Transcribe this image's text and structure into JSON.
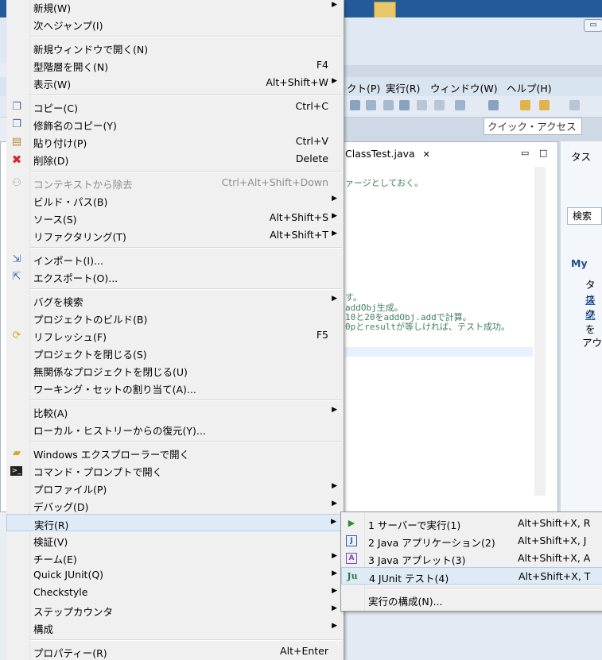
{
  "background": {
    "menubar": [
      "クト(P)",
      "実行(R)",
      "ウィンドウ(W)",
      "ヘルプ(H)"
    ],
    "quick_access": "クイック・アクセス",
    "editor_tab": "ClassTest.java",
    "editor_lines": [
      "ァージとしておく。",
      "す。",
      "addObj生成。",
      "10と20をaddObj.addで計算。",
      "0pとresultが等しければ、テスト成功。"
    ],
    "right_panel": {
      "tasks": "タス",
      "search": "検索",
      "mylyn": "My",
      "task_line": "タス",
      "link": "接続",
      "click_line": "クを",
      "outline": "アウ"
    }
  },
  "menu": {
    "items": [
      {
        "label": "新規(W)",
        "shortcut": "",
        "submenu": true,
        "icon": "",
        "disabled": false
      },
      {
        "label": "次へジャンプ(I)",
        "shortcut": "",
        "submenu": false,
        "icon": "",
        "disabled": false
      },
      {
        "label": "新規ウィンドウで開く(N)",
        "shortcut": "",
        "submenu": false,
        "icon": "",
        "disabled": false
      },
      {
        "label": "型階層を開く(N)",
        "shortcut": "F4",
        "submenu": false,
        "icon": "",
        "disabled": false
      },
      {
        "label": "表示(W)",
        "shortcut": "Alt+Shift+W",
        "submenu": true,
        "icon": "",
        "disabled": false
      },
      {
        "label": "コピー(C)",
        "shortcut": "Ctrl+C",
        "submenu": false,
        "icon": "copy-icon",
        "disabled": false
      },
      {
        "label": "修飾名のコピー(Y)",
        "shortcut": "",
        "submenu": false,
        "icon": "copy-qualified-icon",
        "disabled": false
      },
      {
        "label": "貼り付け(P)",
        "shortcut": "Ctrl+V",
        "submenu": false,
        "icon": "paste-icon",
        "disabled": false
      },
      {
        "label": "削除(D)",
        "shortcut": "Delete",
        "submenu": false,
        "icon": "delete-icon",
        "disabled": false
      },
      {
        "label": "コンテキストから除去",
        "shortcut": "Ctrl+Alt+Shift+Down",
        "submenu": false,
        "icon": "remove-context-icon",
        "disabled": true
      },
      {
        "label": "ビルド・パス(B)",
        "shortcut": "",
        "submenu": true,
        "icon": "",
        "disabled": false
      },
      {
        "label": "ソース(S)",
        "shortcut": "Alt+Shift+S",
        "submenu": true,
        "icon": "",
        "disabled": false
      },
      {
        "label": "リファクタリング(T)",
        "shortcut": "Alt+Shift+T",
        "submenu": true,
        "icon": "",
        "disabled": false
      },
      {
        "label": "インポート(I)...",
        "shortcut": "",
        "submenu": false,
        "icon": "import-icon",
        "disabled": false
      },
      {
        "label": "エクスポート(O)...",
        "shortcut": "",
        "submenu": false,
        "icon": "export-icon",
        "disabled": false
      },
      {
        "label": "バグを検索",
        "shortcut": "",
        "submenu": true,
        "icon": "",
        "disabled": false
      },
      {
        "label": "プロジェクトのビルド(B)",
        "shortcut": "",
        "submenu": false,
        "icon": "",
        "disabled": false
      },
      {
        "label": "リフレッシュ(F)",
        "shortcut": "F5",
        "submenu": false,
        "icon": "refresh-icon",
        "disabled": false
      },
      {
        "label": "プロジェクトを閉じる(S)",
        "shortcut": "",
        "submenu": false,
        "icon": "",
        "disabled": false
      },
      {
        "label": "無関係なプロジェクトを閉じる(U)",
        "shortcut": "",
        "submenu": false,
        "icon": "",
        "disabled": false
      },
      {
        "label": "ワーキング・セットの割り当て(A)...",
        "shortcut": "",
        "submenu": false,
        "icon": "",
        "disabled": false
      },
      {
        "label": "比較(A)",
        "shortcut": "",
        "submenu": true,
        "icon": "",
        "disabled": false
      },
      {
        "label": "ローカル・ヒストリーからの復元(Y)...",
        "shortcut": "",
        "submenu": false,
        "icon": "",
        "disabled": false
      },
      {
        "label": "Windows エクスプローラーで開く",
        "shortcut": "",
        "submenu": false,
        "icon": "explorer-icon",
        "disabled": false
      },
      {
        "label": "コマンド・プロンプトで開く",
        "shortcut": "",
        "submenu": false,
        "icon": "command-prompt-icon",
        "disabled": false
      },
      {
        "label": "プロファイル(P)",
        "shortcut": "",
        "submenu": true,
        "icon": "",
        "disabled": false
      },
      {
        "label": "デバッグ(D)",
        "shortcut": "",
        "submenu": true,
        "icon": "",
        "disabled": false
      },
      {
        "label": "実行(R)",
        "shortcut": "",
        "submenu": true,
        "icon": "",
        "disabled": false,
        "highlighted": true
      },
      {
        "label": "検証(V)",
        "shortcut": "",
        "submenu": false,
        "icon": "",
        "disabled": false
      },
      {
        "label": "チーム(E)",
        "shortcut": "",
        "submenu": true,
        "icon": "",
        "disabled": false
      },
      {
        "label": "Quick JUnit(Q)",
        "shortcut": "",
        "submenu": true,
        "icon": "",
        "disabled": false
      },
      {
        "label": "Checkstyle",
        "shortcut": "",
        "submenu": true,
        "icon": "",
        "disabled": false
      },
      {
        "label": "ステップカウンタ",
        "shortcut": "",
        "submenu": true,
        "icon": "",
        "disabled": false
      },
      {
        "label": "構成",
        "shortcut": "",
        "submenu": true,
        "icon": "",
        "disabled": false
      },
      {
        "label": "プロパティー(R)",
        "shortcut": "Alt+Enter",
        "submenu": false,
        "icon": "",
        "disabled": false
      }
    ]
  },
  "submenu_run": {
    "items": [
      {
        "label": "1 サーバーで実行(1)",
        "shortcut": "Alt+Shift+X, R",
        "icon": "run-server-icon"
      },
      {
        "label": "2 Java アプリケーション(2)",
        "shortcut": "Alt+Shift+X, J",
        "icon": "java-app-icon"
      },
      {
        "label": "3 Java アプレット(3)",
        "shortcut": "Alt+Shift+X, A",
        "icon": "java-applet-icon"
      },
      {
        "label": "4 JUnit テスト(4)",
        "shortcut": "Alt+Shift+X, T",
        "icon": "junit-icon",
        "highlighted": true
      },
      {
        "label": "実行の構成(N)...",
        "shortcut": "",
        "icon": ""
      }
    ]
  },
  "colors": {
    "menu_bg": "#f0f0f0",
    "highlight": "#dfeaf7",
    "disabled_text": "#8d8d8d",
    "delete_red": "#d9262c"
  }
}
